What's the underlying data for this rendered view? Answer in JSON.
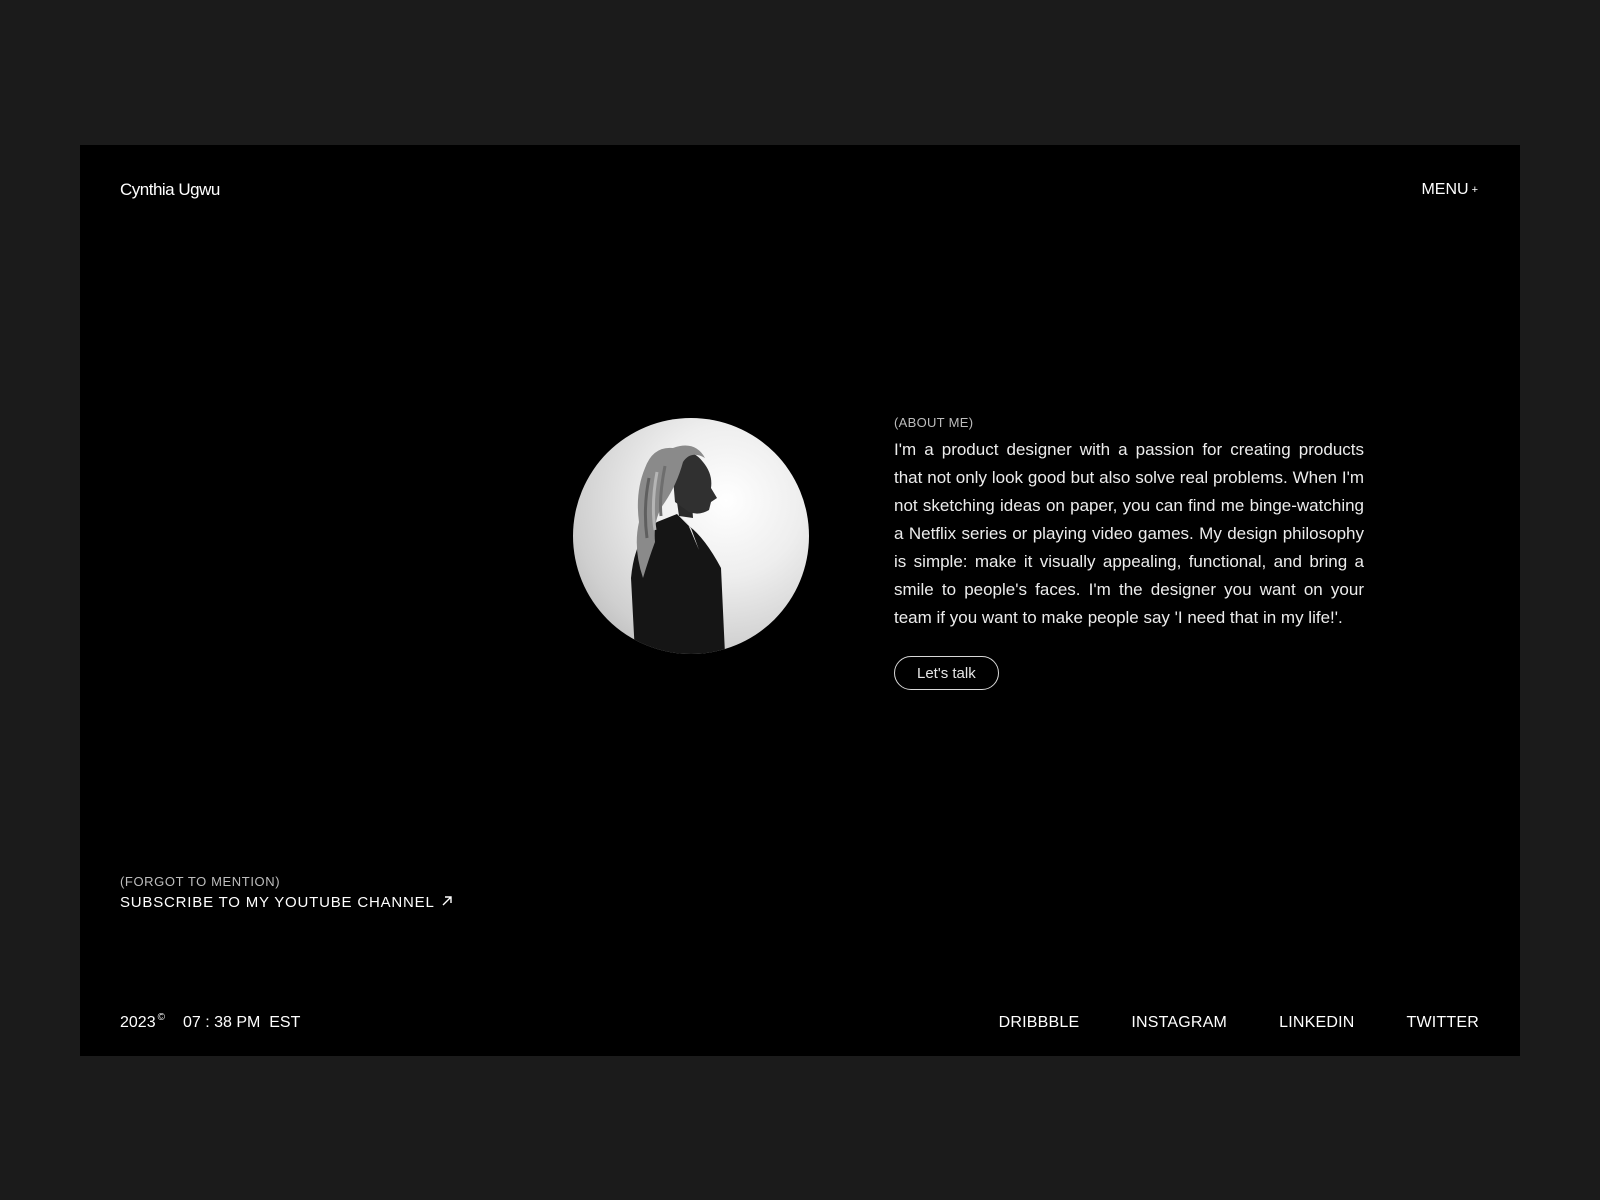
{
  "header": {
    "brand": "Cynthia Ugwu",
    "menu_label": "MENU",
    "menu_icon": "+"
  },
  "about": {
    "label": "(ABOUT ME)",
    "text": "I'm a product designer with a passion for creating products that not only look good but also solve real problems. When I'm not sketching ideas on paper, you can find me binge-watching a Netflix series or playing video games. My design philosophy is simple: make it visually appealing, functional, and bring a smile to people's faces. I'm the designer you want on your team if you want to make people say 'I need that in my life!'.",
    "cta_label": "Let's talk"
  },
  "mention": {
    "label": "(FORGOT TO MENTION)",
    "link_label": "SUBSCRIBE TO MY YOUTUBE CHANNEL",
    "link_icon": "arrow-up-right-icon"
  },
  "footer": {
    "year": "2023",
    "copyright_symbol": "©",
    "time": "07 : 38 PM  EST",
    "socials": [
      "DRIBBBLE",
      "INSTAGRAM",
      "LINKEDIN",
      "TWITTER"
    ]
  },
  "colors": {
    "outer_background": "#1b1b1b",
    "page_background": "#000000",
    "text": "#ffffff",
    "muted_text": "#bdbdbd"
  }
}
